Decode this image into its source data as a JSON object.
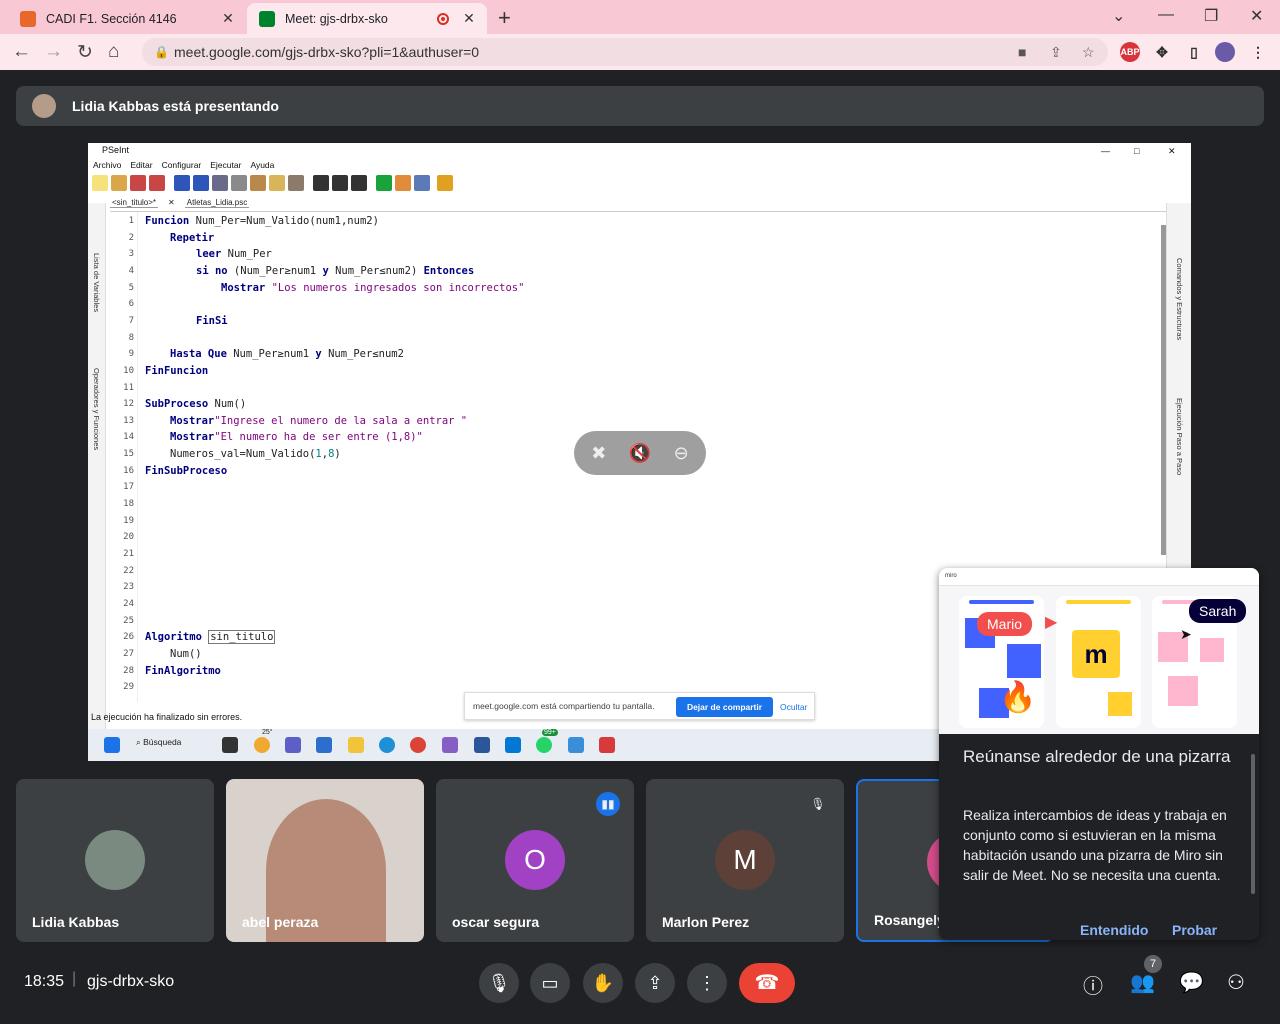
{
  "browser": {
    "tabs": [
      {
        "title": "CADI F1. Sección 4146",
        "favicon_color": "#e8672a"
      },
      {
        "title": "Meet: gjs-drbx-sko",
        "favicon_color": "#00832d"
      }
    ],
    "url": "meet.google.com/gjs-drbx-sko?pli=1&authuser=0",
    "extension_abp": "ABP"
  },
  "presenting": {
    "text": "Lidia Kabbas está presentando"
  },
  "pseint": {
    "window_title": "PSeInt",
    "menu": [
      "Archivo",
      "Editar",
      "Configurar",
      "Ejecutar",
      "Ayuda"
    ],
    "tabs": [
      "<sin_titulo>*",
      "Atletas_Lidia.psc"
    ],
    "left_panel": [
      "Lista de Variables",
      "Operadores y Funciones"
    ],
    "right_panel": [
      "Comandos y Estructuras",
      "Ejecución Paso a Paso"
    ],
    "line_numbers": [
      "1",
      "2",
      "3",
      "4",
      "5",
      "6",
      "7",
      "8",
      "9",
      "10",
      "11",
      "12",
      "13",
      "14",
      "15",
      "16",
      "17",
      "18",
      "19",
      "20",
      "21",
      "22",
      "23",
      "24",
      "25",
      "26",
      "27",
      "28",
      "29"
    ],
    "code": {
      "l1a": "Funcion",
      "l1b": " Num_Per=Num_Valido(num1,num2)",
      "l2": "Repetir",
      "l3a": "leer",
      "l3b": " Num_Per",
      "l4a": "si no",
      "l4b": " (Num_Per≥num1 ",
      "l4c": "y",
      "l4d": " Num_Per≤num2) ",
      "l4e": "Entonces",
      "l5a": "Mostrar",
      "l5b": " \"Los numeros ingresados son incorrectos\"",
      "l7": "FinSi",
      "l9a": "Hasta Que",
      "l9b": " Num_Per≥num1 ",
      "l9c": "y",
      "l9d": " Num_Per≤num2",
      "l10": "FinFuncion",
      "l12a": "SubProceso",
      "l12b": " Num()",
      "l13a": "Mostrar",
      "l13b": "\"Ingrese el numero de la sala a entrar \"",
      "l14a": "Mostrar",
      "l14b": "\"El numero ha de ser entre (1,8)\"",
      "l15a": "Numeros_val=Num_Valido(",
      "l15b": "1",
      "l15c": ",",
      "l15d": "8",
      "l15e": ")",
      "l16": "FinSubProceso",
      "l26a": "Algoritmo",
      "l26b": "sin_titulo",
      "l27": "Num()",
      "l28": "FinAlgoritmo"
    },
    "status": "La ejecución ha finalizado sin errores."
  },
  "share_bar": {
    "text": "meet.google.com está compartiendo tu pantalla.",
    "stop": "Dejar de compartir",
    "hide": "Ocultar"
  },
  "taskbar": {
    "search": "Búsqueda",
    "weather_temp": "25°",
    "whatsapp_badge": "99+"
  },
  "participants": [
    {
      "name": "Lidia Kabbas",
      "avatar_color": "#7a8a80"
    },
    {
      "name": "abel peraza"
    },
    {
      "name": "oscar segura",
      "initial": "O",
      "avatar_color": "#a142c4"
    },
    {
      "name": "Marlon Perez",
      "initial": "M",
      "avatar_color": "#5d4037"
    },
    {
      "name": "Rosangely",
      "avatar_color": "#d14c8a"
    }
  ],
  "bottom_bar": {
    "time": "18:35",
    "separator": "|",
    "meeting_code": "gjs-drbx-sko",
    "people_count": "7"
  },
  "miro_popup": {
    "chips": {
      "mario": "Mario",
      "sarah": "Sarah"
    },
    "title": "Reúnanse alrededor de una pizarra",
    "body": "Realiza intercambios de ideas y trabaja en conjunto como si estuvieran en la misma habitación usando una pizarra de Miro sin salir de Meet. No se necesita una cuenta.",
    "ok": "Entendido",
    "try": "Probar",
    "brand": "miro",
    "colors": {
      "blue": "#4262ff",
      "yellow": "#ffd02f",
      "pink": "#ffb6cf",
      "red": "#f24e4e"
    }
  },
  "colors": {
    "meet_bg": "#202124",
    "tile_bg": "#3c4043",
    "end_call": "#ea4335",
    "link_blue": "#8ab4f8"
  }
}
